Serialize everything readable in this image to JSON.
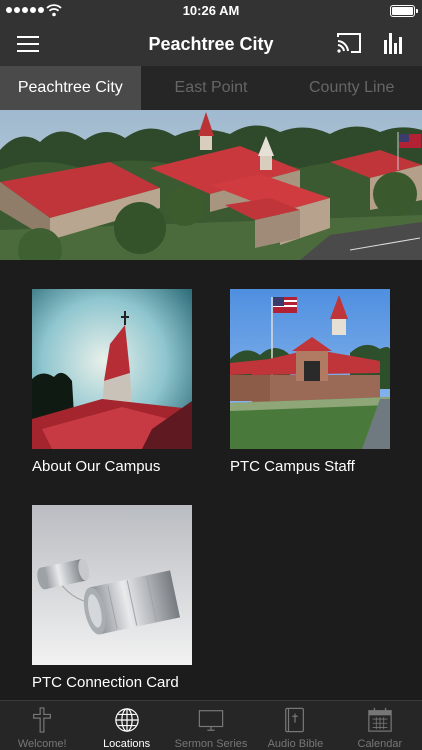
{
  "status": {
    "time": "10:26 AM"
  },
  "navbar": {
    "title": "Peachtree City"
  },
  "tabs": [
    {
      "label": "Peachtree City",
      "active": true
    },
    {
      "label": "East Point",
      "active": false
    },
    {
      "label": "County Line",
      "active": false
    }
  ],
  "cards": [
    {
      "label": "About Our Campus",
      "image": "church-steeple-photo"
    },
    {
      "label": "PTC Campus Staff",
      "image": "church-building-flag-photo"
    },
    {
      "label": "PTC Connection Card",
      "image": "tin-can-phone-photo"
    }
  ],
  "tabbar": [
    {
      "label": "Welcome!",
      "icon": "cross-icon",
      "active": false
    },
    {
      "label": "Locations",
      "icon": "globe-icon",
      "active": true
    },
    {
      "label": "Sermon Series",
      "icon": "tv-icon",
      "active": false
    },
    {
      "label": "Audio Bible",
      "icon": "bible-icon",
      "active": false
    },
    {
      "label": "Calendar",
      "icon": "calendar-icon",
      "active": false
    }
  ],
  "colors": {
    "nav_bg": "#333333",
    "background": "#1c1c1c",
    "roof_red": "#c0353a"
  }
}
